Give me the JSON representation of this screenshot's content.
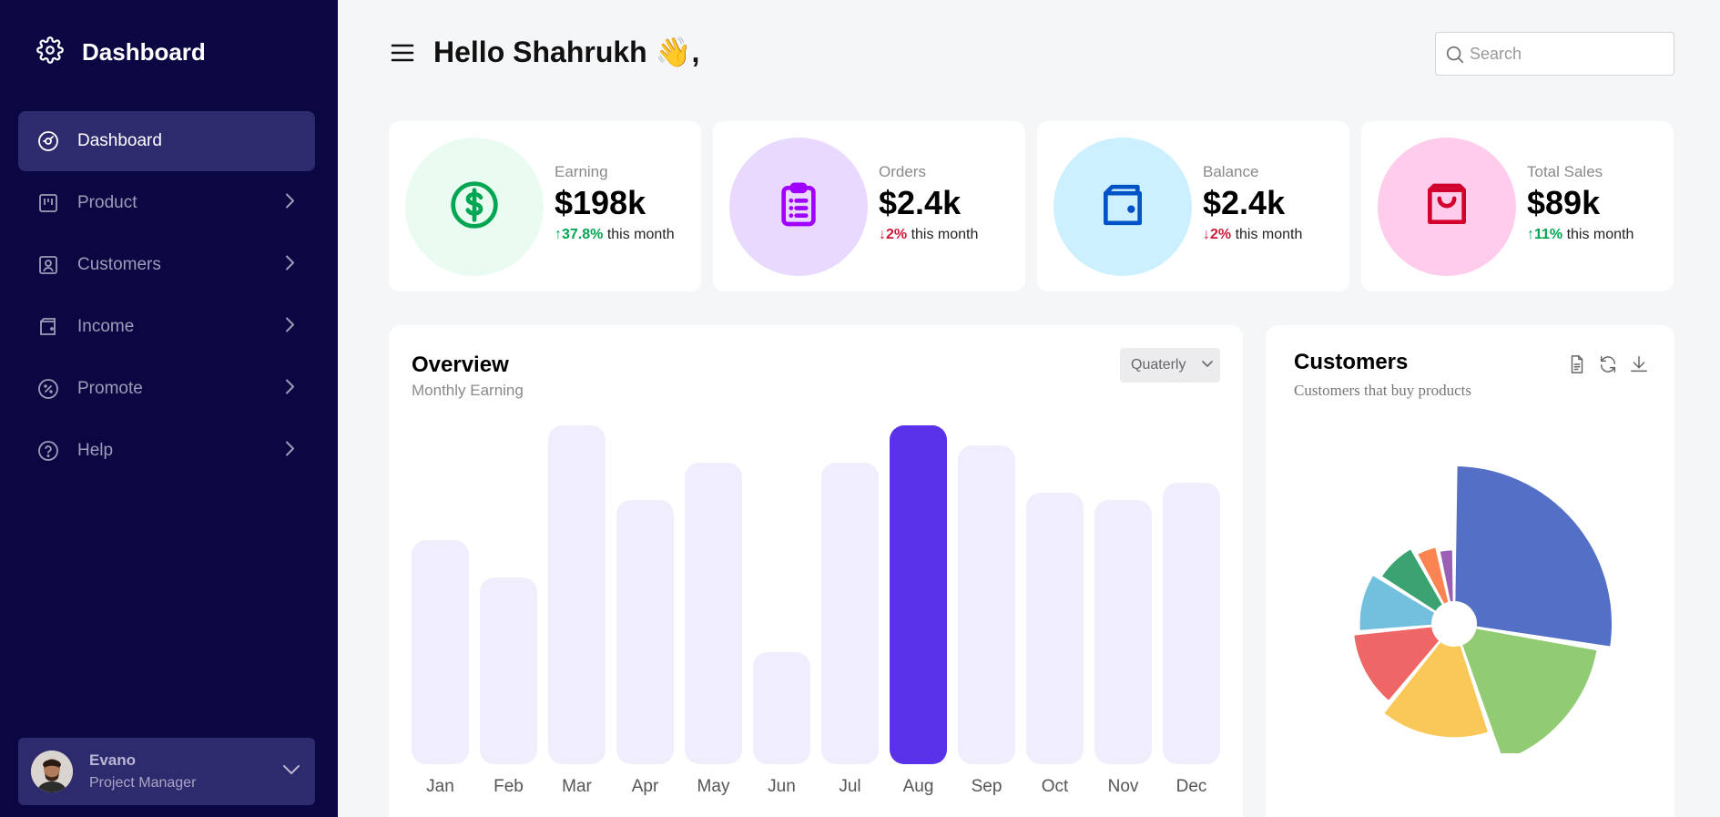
{
  "sidebar": {
    "brand": "Dashboard",
    "items": [
      {
        "label": "Dashboard",
        "icon": "speedometer-icon",
        "active": true
      },
      {
        "label": "Product",
        "icon": "product-icon"
      },
      {
        "label": "Customers",
        "icon": "user-badge-icon"
      },
      {
        "label": "Income",
        "icon": "wallet-icon"
      },
      {
        "label": "Promote",
        "icon": "discount-icon"
      },
      {
        "label": "Help",
        "icon": "help-icon"
      }
    ],
    "profile": {
      "name": "Evano",
      "role": "Project Manager"
    }
  },
  "header": {
    "greeting": "Hello Shahrukh 👋,",
    "search_placeholder": "Search"
  },
  "stats": [
    {
      "label": "Earning",
      "value": "$198k",
      "change": "37.8%",
      "direction": "up",
      "suffix": " this month",
      "icon": "dollar-icon",
      "color": "#00a651",
      "bg": "#eafcf1"
    },
    {
      "label": "Orders",
      "value": "$2.4k",
      "change": "2%",
      "direction": "down",
      "suffix": " this month",
      "icon": "clipboard-icon",
      "color": "#9f00ff",
      "bg": "#e9d9ff"
    },
    {
      "label": "Balance",
      "value": "$2.4k",
      "change": "2%",
      "direction": "down",
      "suffix": " this month",
      "icon": "wallet-icon",
      "color": "#0053c7",
      "bg": "#ccf0ff"
    },
    {
      "label": "Total Sales",
      "value": "$89k",
      "change": "11%",
      "direction": "up",
      "suffix": " this month",
      "icon": "shopping-bag-icon",
      "color": "#d1002d",
      "bg": "#ffccec"
    }
  ],
  "overview": {
    "title": "Overview",
    "subtitle": "Monthly Earning",
    "period": "Quaterly"
  },
  "customers": {
    "title": "Customers",
    "subtitle": "Customers that buy products"
  },
  "colors": {
    "sidebar": "#0b0742",
    "accent": "#5932ea",
    "bar": "#f0eefc"
  },
  "chart_data": [
    {
      "type": "bar",
      "categories": [
        "Jan",
        "Feb",
        "Mar",
        "Apr",
        "May",
        "Jun",
        "Jul",
        "Aug",
        "Sep",
        "Oct",
        "Nov",
        "Dec"
      ],
      "values": [
        66,
        55,
        100,
        78,
        89,
        33,
        89,
        100,
        94,
        80,
        78,
        83
      ],
      "highlight": "Aug",
      "colors": {
        "default": "#f0eefc",
        "highlight": "#5932ea"
      }
    },
    {
      "type": "pie",
      "variant": "polar-area",
      "slices": [
        {
          "value": 24,
          "radius": 1.0,
          "color": "#5470c6"
        },
        {
          "value": 15,
          "radius": 0.92,
          "color": "#91cc75"
        },
        {
          "value": 14,
          "radius": 0.72,
          "color": "#fac858"
        },
        {
          "value": 11,
          "radius": 0.64,
          "color": "#ee6666"
        },
        {
          "value": 9,
          "radius": 0.6,
          "color": "#73c0de"
        },
        {
          "value": 7,
          "radius": 0.55,
          "color": "#3ba272"
        },
        {
          "value": 4,
          "radius": 0.5,
          "color": "#fc8452"
        },
        {
          "value": 3,
          "radius": 0.47,
          "color": "#9a60b4"
        }
      ]
    }
  ]
}
